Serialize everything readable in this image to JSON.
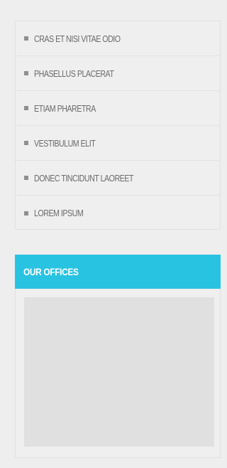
{
  "menu": {
    "items": [
      {
        "label": "CRAS ET NISI VITAE ODIO"
      },
      {
        "label": "PHASELLUS PLACERAT"
      },
      {
        "label": "ETIAM PHARETRA"
      },
      {
        "label": "VESTIBULUM ELIT"
      },
      {
        "label": "DONEC TINCIDUNT LAOREET"
      },
      {
        "label": "LOREM IPSUM"
      }
    ],
    "bullet_icon": "square-bullet-icon"
  },
  "offices": {
    "title": "OUR OFFICES",
    "header_color": "#29c3e2"
  }
}
